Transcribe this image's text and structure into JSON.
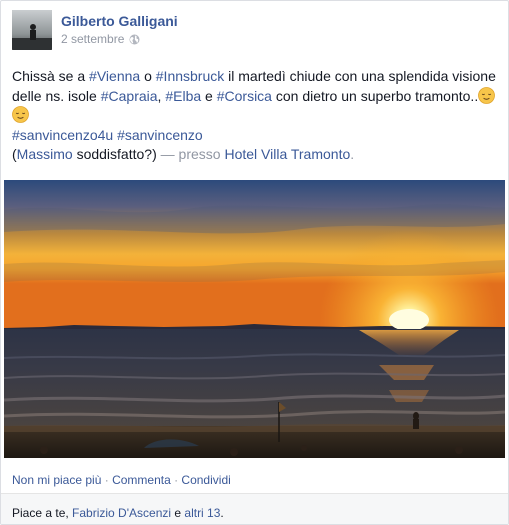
{
  "post": {
    "author": "Gilberto Galligani",
    "date": "2 settembre",
    "text": {
      "line1_a": "Chissà se a ",
      "tag_vienna": "#Vienna",
      "line1_b": " o ",
      "tag_innsbruck": "#Innsbruck",
      "line1_c": " il martedì chiude con una splendida visione delle ns. isole ",
      "tag_capraia": "#Capraia",
      "sep1": ", ",
      "tag_elba": "#Elba",
      "sep2": " e ",
      "tag_corsica": "#Corsica",
      "line1_d": " con dietro un superbo tramonto..",
      "tag_sanvincenzo4u": "#sanvincenzo4u",
      "space": " ",
      "tag_sanvincenzo": "#sanvincenzo",
      "open_paren": "(",
      "tag_massimo": "Massimo",
      "massimo_rest": " soddisfatto?)",
      "presso": " — presso ",
      "place": "Hotel Villa Tramonto",
      "period": "."
    },
    "actions": {
      "unlike": "Non mi piace più",
      "sep": " · ",
      "comment": "Commenta",
      "share": "Condividi"
    },
    "likes": {
      "prefix": "Piace a te, ",
      "friend": "Fabrizio D'Ascenzi",
      "middle": " e ",
      "others": "altri 13",
      "period": "."
    },
    "icons": {
      "audience": "globe-icon",
      "emoji": "relieved-face-emoji-icon"
    },
    "colors": {
      "link": "#3b5998",
      "muted": "#9197a3",
      "text": "#141823"
    }
  }
}
